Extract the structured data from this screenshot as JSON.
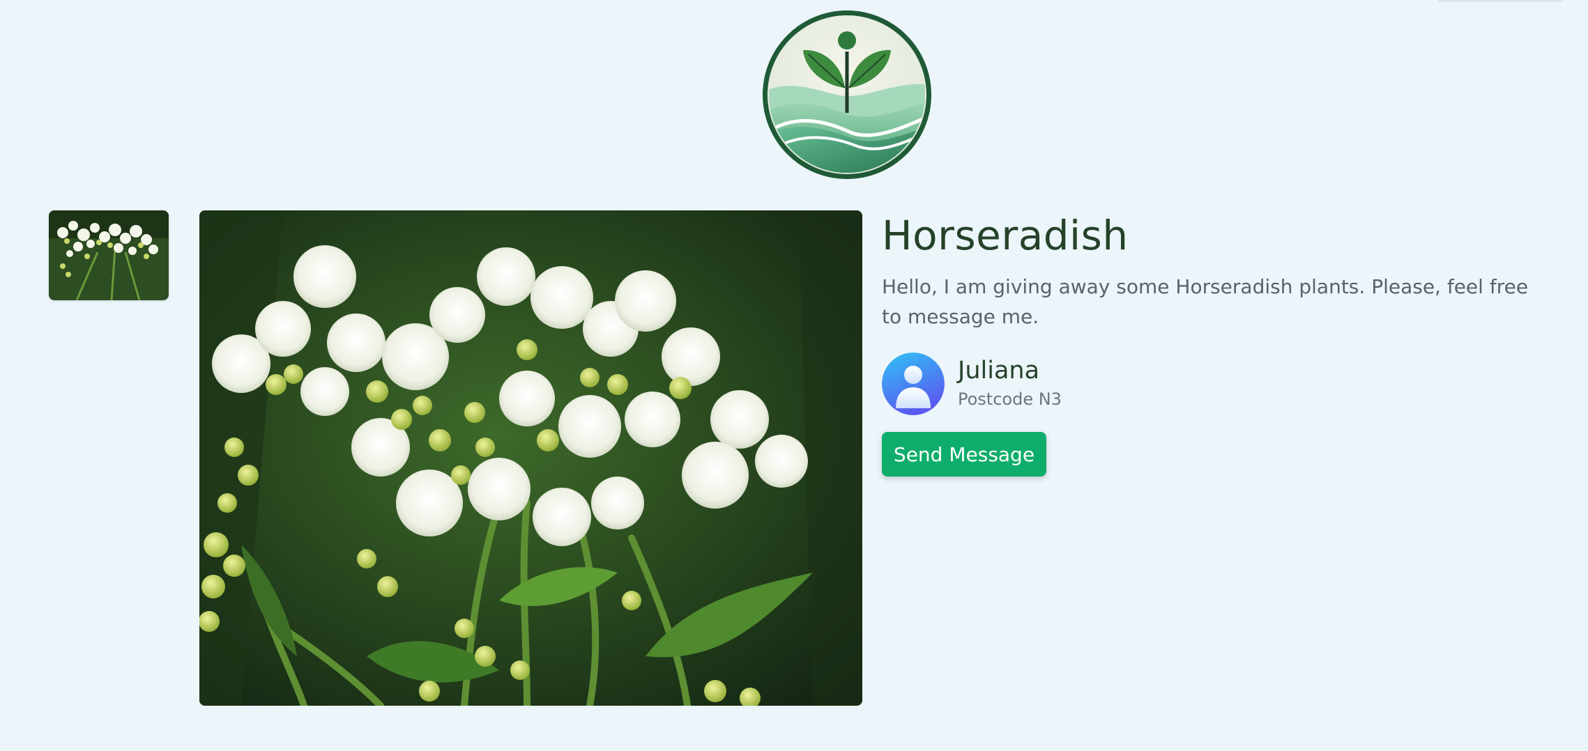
{
  "colors": {
    "page_background": "#ecf5fa",
    "title": "#254229",
    "body_text": "#5b6166",
    "button": "#0fad6c",
    "button_text": "#ffffff",
    "avatar_gradient": [
      "#2fc3f5",
      "#5a5af0"
    ]
  },
  "logo": {
    "icon": "sprout-over-waves-icon"
  },
  "gallery": {
    "thumbnail_icon": "horseradish-flowers-thumbnail",
    "main_image_icon": "horseradish-flowers-photo"
  },
  "listing": {
    "title": "Horseradish",
    "description": "Hello, I am giving away some Horseradish plants. Please, feel free to message me."
  },
  "owner": {
    "avatar_icon": "user-avatar-icon",
    "name": "Juliana",
    "postcode": "Postcode N3"
  },
  "actions": {
    "send_message_label": "Send Message"
  }
}
